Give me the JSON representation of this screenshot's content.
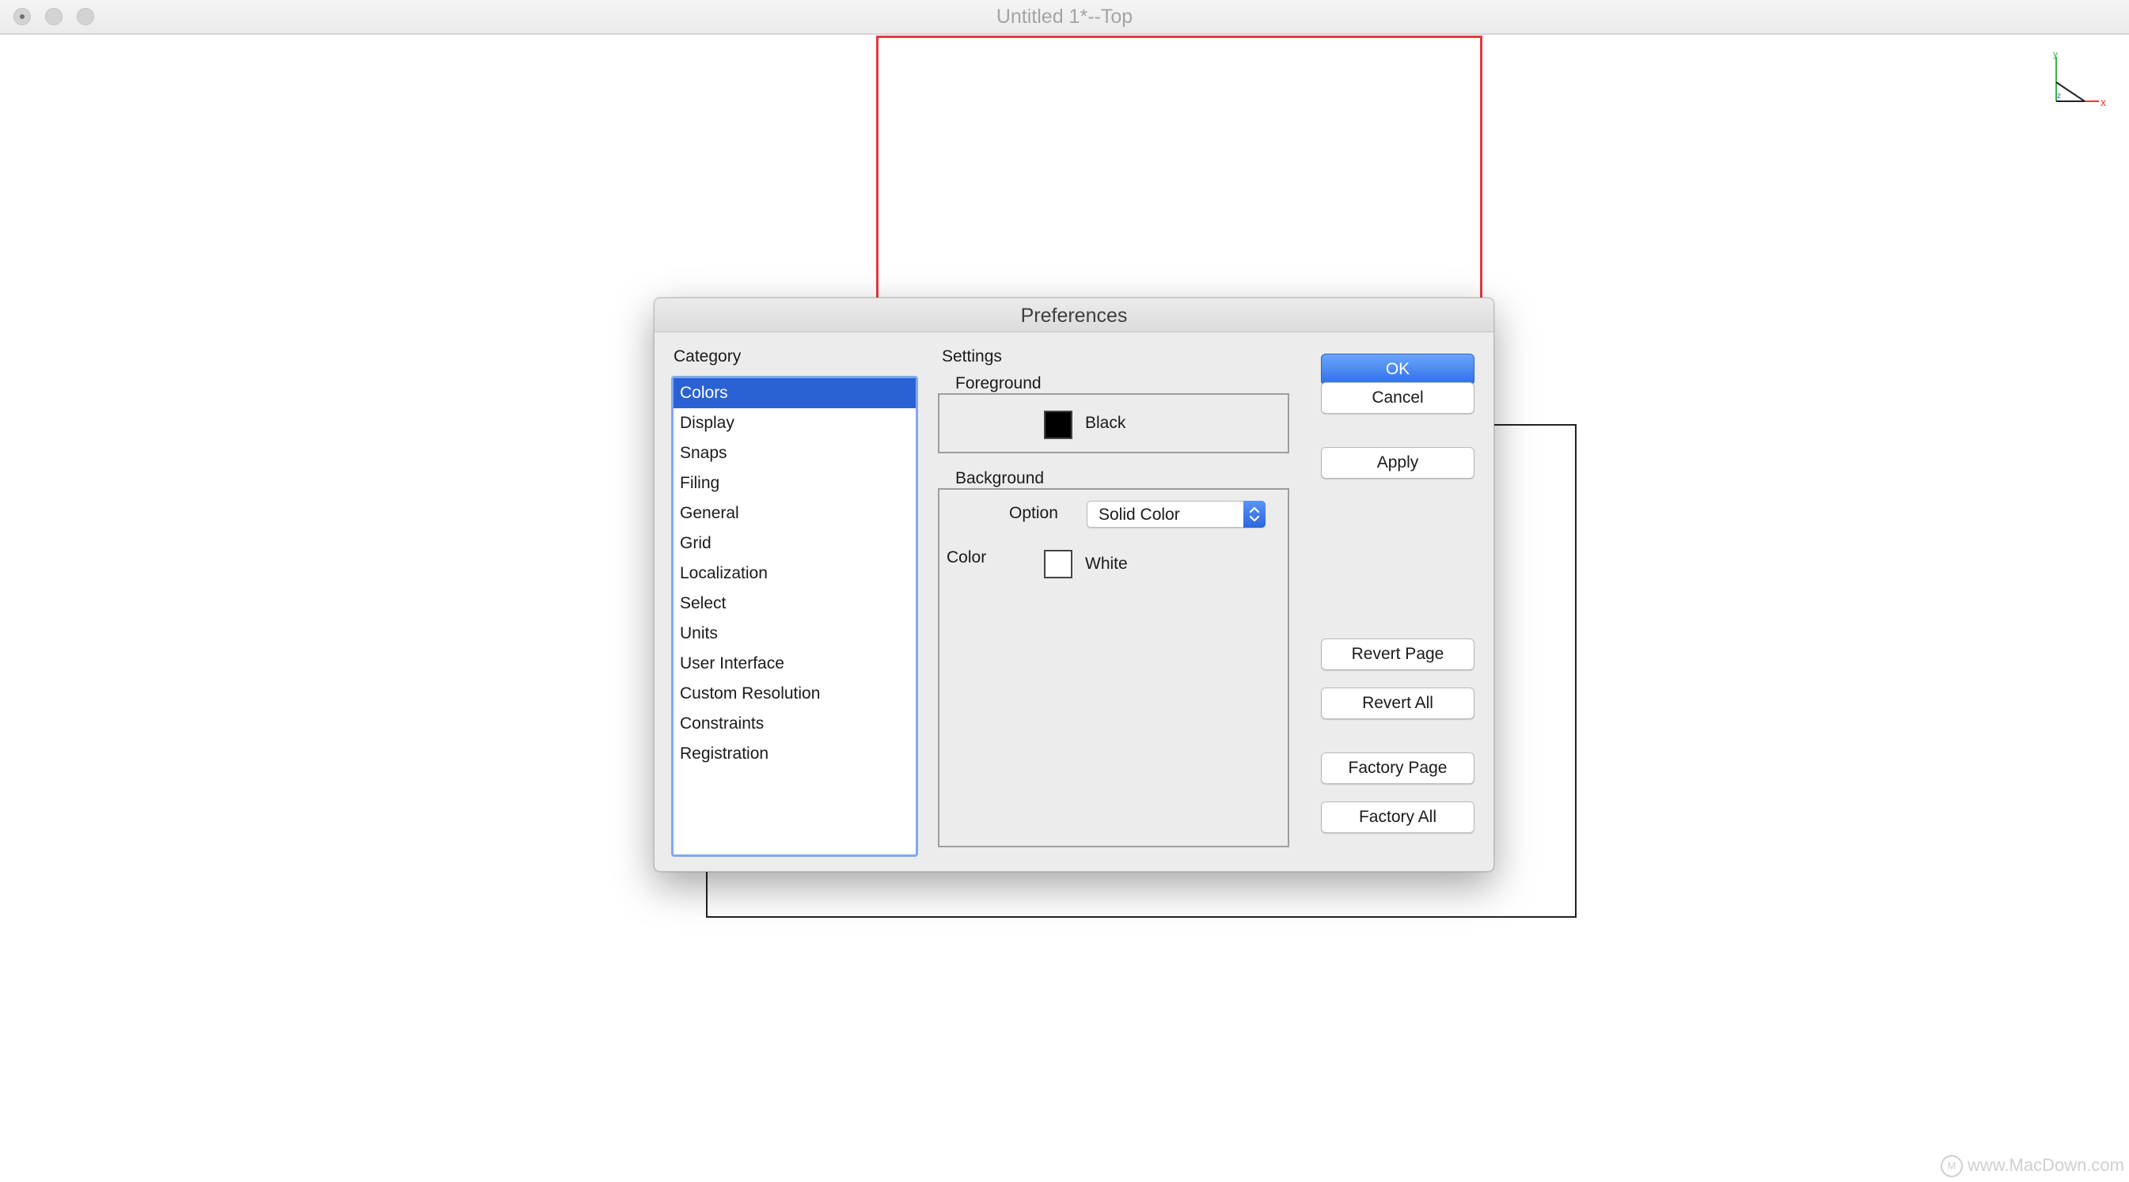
{
  "window": {
    "title": "Untitled 1*--Top"
  },
  "canvas": {
    "axis_y_label": "y",
    "axis_x_label": "x",
    "axis_z_label": "z",
    "colors": {
      "red_shape": "#e33a3f",
      "black_shape": "#222222",
      "axis_x": "#e33a3f",
      "axis_y": "#35b34a",
      "axis_z": "#3a5bd9"
    }
  },
  "watermark": {
    "text": "www.MacDown.com"
  },
  "dialog": {
    "title": "Preferences",
    "category_label": "Category",
    "settings_label": "Settings",
    "categories": [
      "Colors",
      "Display",
      "Snaps",
      "Filing",
      "General",
      "Grid",
      "Localization",
      "Select",
      "Units",
      "User Interface",
      "Custom Resolution",
      "Constraints",
      "Registration"
    ],
    "selected_category": "Colors",
    "foreground": {
      "group_label": "Foreground",
      "color_name": "Black",
      "color_hex": "#000000"
    },
    "background": {
      "group_label": "Background",
      "option_label": "Option",
      "option_value": "Solid Color",
      "color_label": "Color",
      "color_name": "White",
      "color_hex": "#ffffff"
    },
    "buttons": {
      "ok": "OK",
      "cancel": "Cancel",
      "apply": "Apply",
      "revert_page": "Revert Page",
      "revert_all": "Revert All",
      "factory_page": "Factory Page",
      "factory_all": "Factory All"
    },
    "accent_color": "#2a62d5"
  }
}
